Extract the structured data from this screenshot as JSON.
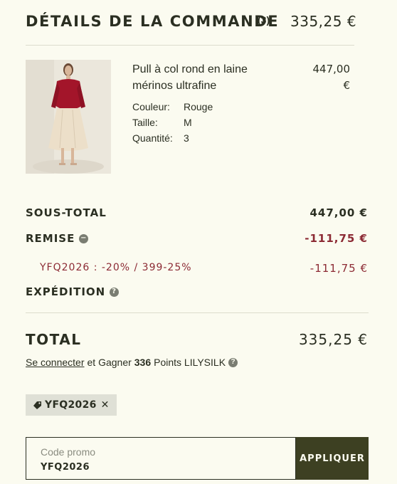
{
  "header": {
    "title": "DÉTAILS DE LA COMMANDE",
    "count": "(3)",
    "total": "335,25 €"
  },
  "product": {
    "name": "Pull à col rond en laine mérinos ultrafine",
    "price_amount": "447,00",
    "price_currency": "€",
    "attributes": [
      {
        "label": "Couleur:",
        "value": "Rouge"
      },
      {
        "label": "Taille:",
        "value": "M"
      },
      {
        "label": "Quantité:",
        "value": "3"
      }
    ]
  },
  "summary": {
    "subtotal_label": "SOUS-TOTAL",
    "subtotal_value": "447,00 €",
    "discount_label": "REMISE",
    "discount_value": "-111,75 €",
    "discount_code_line": "YFQ2026 : -20% / 399-25%",
    "discount_code_value": "-111,75 €",
    "shipping_label": "EXPÉDITION"
  },
  "total": {
    "label": "TOTAL",
    "value": "335,25 €"
  },
  "points": {
    "link": "Se connecter",
    "text_before": "et Gagner",
    "amount": "336",
    "text_after": "Points LILYSILK"
  },
  "chip": {
    "code": "YFQ2026"
  },
  "promo": {
    "label": "Code promo",
    "value": "YFQ2026",
    "button": "APPLIQUER"
  },
  "colors": {
    "background": "#fbfbf0",
    "text": "#2b2f22",
    "discount": "#8c2a34",
    "button": "#3d4022"
  }
}
